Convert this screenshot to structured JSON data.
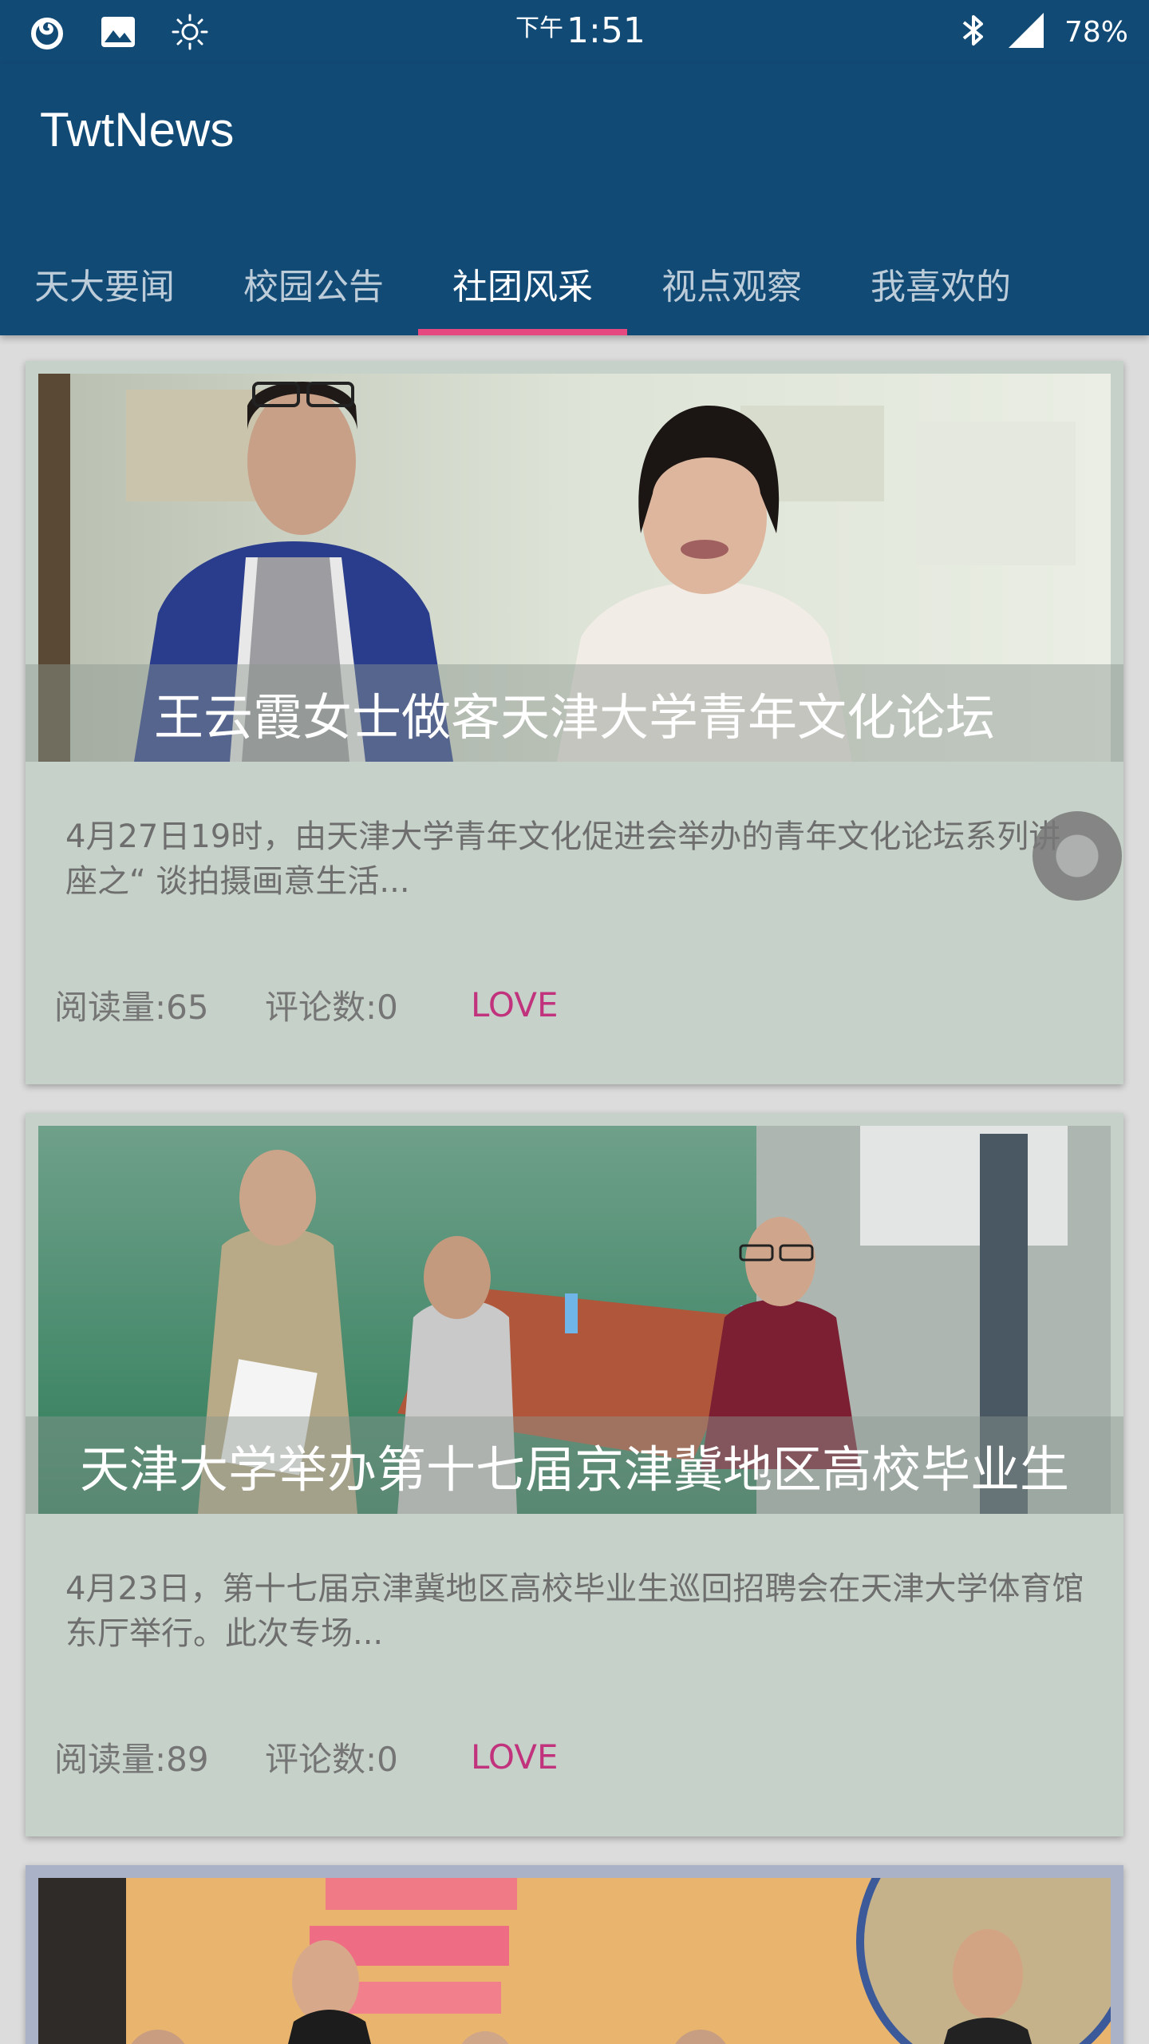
{
  "status_bar": {
    "ampm": "下午",
    "time": "1:51",
    "battery": "78%",
    "icons": [
      "app-logo-icon",
      "image-icon",
      "brightness-icon",
      "bluetooth-icon",
      "signal-icon"
    ]
  },
  "app": {
    "title": "TwtNews",
    "accent_color": "#124a76",
    "indicator_color": "#e6497f"
  },
  "tabs": [
    {
      "label": "天大要闻",
      "active": false
    },
    {
      "label": "校园公告",
      "active": false
    },
    {
      "label": "社团风采",
      "active": true
    },
    {
      "label": "视点观察",
      "active": false
    },
    {
      "label": "我喜欢的",
      "active": false
    }
  ],
  "cards": [
    {
      "title": "王云霞女士做客天津大学青年文化论坛",
      "summary": "4月27日19时，由天津大学青年文化促进会举办的青年文化论坛系列讲座之“ 谈拍摄画意生活...",
      "reads": "阅读量:65",
      "comments": "评论数:0",
      "love": "LOVE"
    },
    {
      "title": "天津大学举办第十七届京津冀地区高校毕业生",
      "summary": "4月23日，第十七届京津冀地区高校毕业生巡回招聘会在天津大学体育馆东厅举行。此次专场...",
      "reads": "阅读量:89",
      "comments": "评论数:0",
      "love": "LOVE"
    }
  ]
}
